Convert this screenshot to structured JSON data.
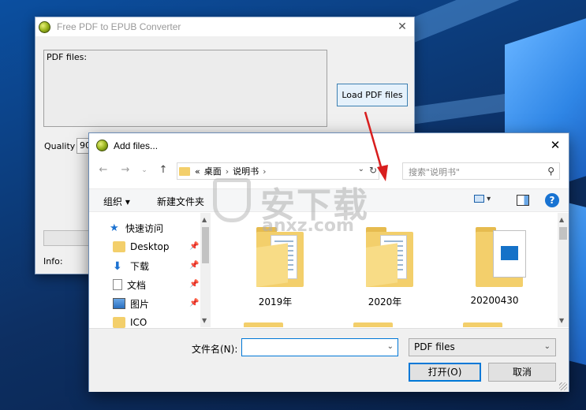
{
  "converter": {
    "title": "Free PDF to EPUB Converter",
    "pdf_files_label": "PDF files:",
    "load_button": "Load PDF files",
    "quality_label": "Quality",
    "quality_value": "90",
    "info_label": "Info:"
  },
  "dialog": {
    "title": "Add files...",
    "address": {
      "overflow": "«",
      "segments": [
        "桌面",
        "说明书"
      ]
    },
    "search_placeholder": "搜索\"说明书\"",
    "toolbar": {
      "organize": "组织 ▾",
      "new_folder": "新建文件夹"
    },
    "nav_items": [
      {
        "label": "快速访问",
        "icon": "star-icon"
      },
      {
        "label": "Desktop",
        "icon": "folder-icon",
        "pinned": true
      },
      {
        "label": "下载",
        "icon": "download-icon",
        "pinned": true
      },
      {
        "label": "文档",
        "icon": "document-icon",
        "pinned": true
      },
      {
        "label": "图片",
        "icon": "picture-icon",
        "pinned": true
      },
      {
        "label": "ICO",
        "icon": "folder-icon"
      }
    ],
    "files": [
      {
        "label": "2019年",
        "kind": "folder"
      },
      {
        "label": "2020年",
        "kind": "folder"
      },
      {
        "label": "20200430",
        "kind": "video-folder"
      }
    ],
    "filename_label": "文件名(N):",
    "filename_value": "",
    "filetype": "PDF files",
    "open_button": "打开(O)",
    "cancel_button": "取消"
  },
  "watermark": {
    "text": "安下载",
    "subtext": "anxz.com"
  },
  "colors": {
    "accent": "#0078d7",
    "annotation_arrow": "#d81e1e",
    "folder": "#f3cf6b"
  }
}
